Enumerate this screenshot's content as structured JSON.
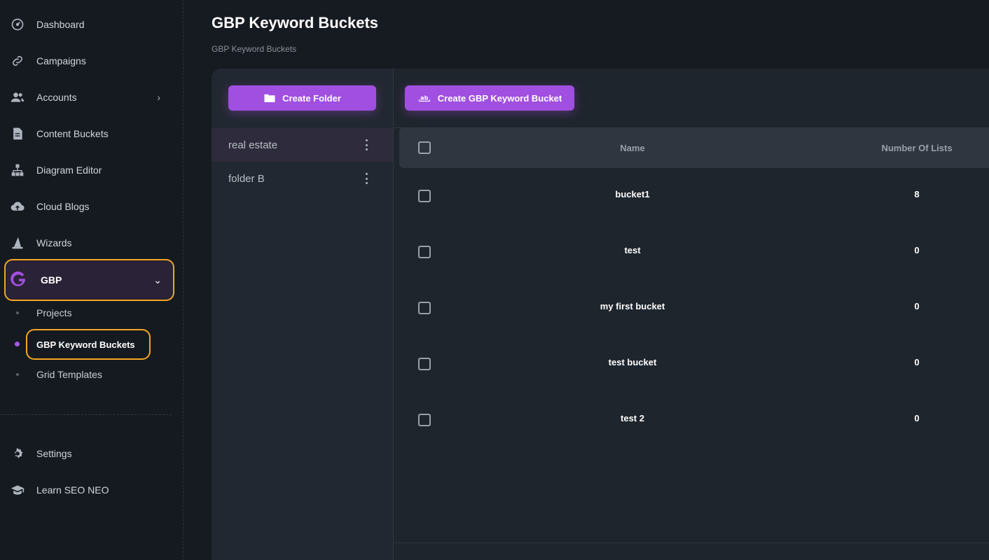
{
  "sidebar": {
    "items": [
      {
        "label": "Dashboard",
        "icon": "dashboard-gauge-icon"
      },
      {
        "label": "Campaigns",
        "icon": "link-icon"
      },
      {
        "label": "Accounts",
        "icon": "users-icon"
      },
      {
        "label": "Content Buckets",
        "icon": "document-icon"
      },
      {
        "label": "Diagram Editor",
        "icon": "sitemap-icon"
      },
      {
        "label": "Cloud Blogs",
        "icon": "cloud-upload-icon"
      },
      {
        "label": "Wizards",
        "icon": "wizard-hat-icon"
      }
    ],
    "gbp": {
      "label": "GBP",
      "icon": "g-logo-icon"
    },
    "gbp_sub": [
      {
        "label": "Projects"
      },
      {
        "label": "GBP Keyword Buckets"
      },
      {
        "label": "Grid Templates"
      }
    ],
    "bottom": [
      {
        "label": "Settings",
        "icon": "gear-icon"
      },
      {
        "label": "Learn SEO NEO",
        "icon": "graduation-cap-icon"
      }
    ]
  },
  "page": {
    "title": "GBP Keyword Buckets",
    "breadcrumb": "GBP Keyword Buckets"
  },
  "toolbar": {
    "create_folder": "Create Folder",
    "create_bucket": "Create GBP Keyword Bucket"
  },
  "folders": [
    {
      "name": "real estate",
      "active": true
    },
    {
      "name": "folder B",
      "active": false
    }
  ],
  "table": {
    "columns": [
      "Name",
      "Number Of Lists"
    ],
    "rows": [
      {
        "name": "bucket1",
        "lists": "8"
      },
      {
        "name": "test",
        "lists": "0"
      },
      {
        "name": "my first bucket",
        "lists": "0"
      },
      {
        "name": "test bucket",
        "lists": "0"
      },
      {
        "name": "test 2",
        "lists": "0"
      }
    ]
  },
  "colors": {
    "accent": "#a04fe0",
    "highlight": "#f5a623",
    "background": "#161b22"
  }
}
